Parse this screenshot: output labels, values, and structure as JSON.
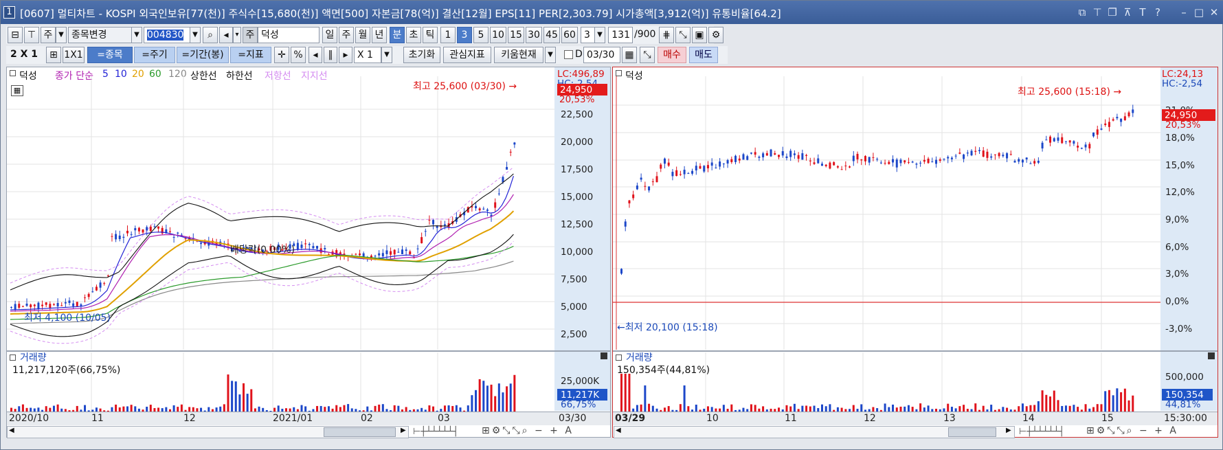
{
  "titlebar": {
    "number": "1",
    "title": "[0607] 멀티차트 - KOSPI 외국인보유[77(천)] 주식수[15,680(천)] 액면[500] 자본금[78(억)] 결산[12월] EPS[11] PER[2,303.79] 시가총액[3,912(억)] 유통비율[64.2]"
  },
  "toolbar1": {
    "period_type": "주",
    "stock_change_label": "종목변경",
    "stock_code": "004830",
    "ju_badge": "주",
    "stock_name": "덕성",
    "period_buttons": [
      "일",
      "주",
      "월",
      "년",
      "분",
      "초",
      "틱"
    ],
    "minute_options": [
      "1",
      "3",
      "5",
      "10",
      "15",
      "30",
      "45",
      "60"
    ],
    "interval_value": "3",
    "count_value": "131",
    "count_max": "/900"
  },
  "toolbar2": {
    "layout_label": "2 X 1",
    "one_by_one": "1X1",
    "stock_btn": "=종목",
    "period_btn": "=주기",
    "range_btn": "=기간(봉)",
    "indicator_btn": "=지표",
    "zoom_value": "X 1",
    "reset_btn": "초기화",
    "watch_btn": "관심지표",
    "kiwoom_btn": "키움현재",
    "d_label": "D",
    "date_value": "03/30",
    "buy_btn": "매수",
    "sell_btn": "매도"
  },
  "left_chart": {
    "stock_label": "덕성",
    "legend": [
      {
        "text": "종가 단순",
        "color": "#b01fb0"
      },
      {
        "text": "5",
        "color": "#2424d6"
      },
      {
        "text": "10",
        "color": "#2424d6"
      },
      {
        "text": "20",
        "color": "#e0a000"
      },
      {
        "text": "60",
        "color": "#2a9a2a"
      },
      {
        "text": "120",
        "color": "#888888"
      },
      {
        "text": "상한선",
        "color": "#111111"
      },
      {
        "text": "하한선",
        "color": "#111111"
      },
      {
        "text": "저항선",
        "color": "#d48cf0"
      },
      {
        "text": "지지선",
        "color": "#d48cf0"
      }
    ],
    "high_annotation": "최고 25,600 (03/30) →",
    "low_annotation": "최저 4,100 (10/05)",
    "dividend_annotation": "배당락(0.00%)",
    "lc": "LC:496,89",
    "hc": "HC:-2,54",
    "current_price": "24,950",
    "change_pct": "20,53%",
    "y_ticks": [
      "22,500",
      "20,000",
      "17,500",
      "15,000",
      "12,500",
      "10,000",
      "7,500",
      "5,000",
      "2,500"
    ],
    "volume": {
      "label": "거래량",
      "total": "11,217,120주(66,75%)",
      "tick": "25,000K",
      "current": "11,217K",
      "pct": "66,75%"
    },
    "x_ticks": [
      "2020/10",
      "11",
      "12",
      "2021/01",
      "02",
      "03"
    ],
    "x_end": "03/30"
  },
  "right_chart": {
    "stock_label": "덕성",
    "high_annotation": "최고 25,600 (15:18) →",
    "low_annotation": "←최저 20,100 (15:18)",
    "lc": "LC:24,13",
    "hc": "HC:-2,54",
    "current_price": "24,950",
    "change_pct": "20,53%",
    "y_ticks": [
      "21,0%",
      "18,0%",
      "15,0%",
      "12,0%",
      "9,0%",
      "6,0%",
      "3,0%",
      "0,0%",
      "-3,0%"
    ],
    "volume": {
      "label": "거래량",
      "total": "150,354주(44,81%)",
      "tick": "500,000",
      "current": "150,354",
      "pct": "44,81%"
    },
    "x_ticks": [
      "03/29",
      "10",
      "11",
      "12",
      "13",
      "14",
      "15"
    ],
    "x_end": "15:30:00"
  },
  "colors": {
    "up": "#e0121b",
    "down": "#1c47c9",
    "accent": "#3a5d98"
  }
}
